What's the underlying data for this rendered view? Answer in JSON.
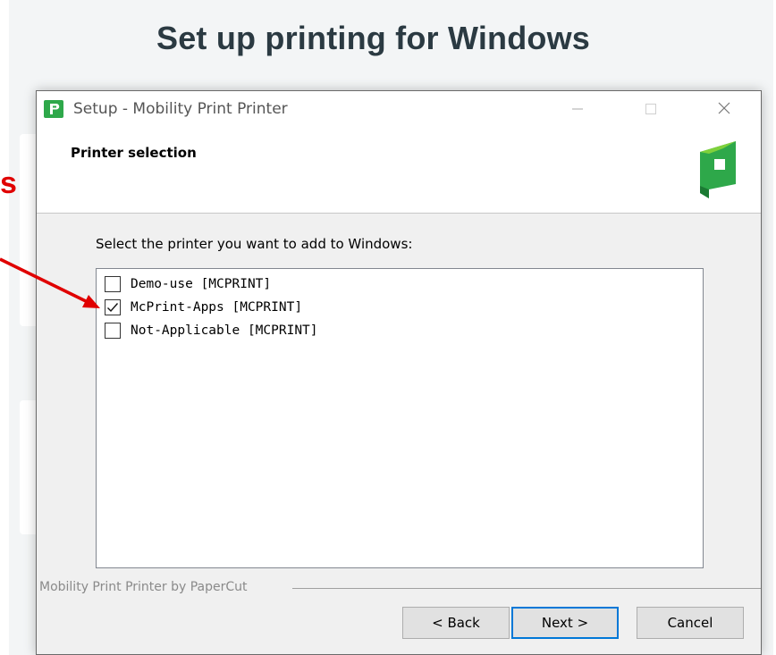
{
  "page": {
    "title": "Set up printing for Windows",
    "annotation_letter": "s",
    "annotation_color": "#e00000"
  },
  "dialog": {
    "window_title": "Setup - Mobility Print Printer",
    "controls": {
      "minimize_icon": "minimize-icon",
      "maximize_icon": "maximize-icon",
      "close_icon": "close-icon"
    },
    "header_title": "Printer selection",
    "logo_icon": "papercut-logo-icon",
    "instruction": "Select the printer you want to add to Windows:",
    "printers": [
      {
        "label": "Demo-use [MCPRINT]",
        "checked": false
      },
      {
        "label": "McPrint-Apps [MCPRINT]",
        "checked": true
      },
      {
        "label": "Not-Applicable [MCPRINT]",
        "checked": false
      }
    ],
    "footer_brand": "Mobility Print Printer by PaperCut",
    "buttons": {
      "back": "< Back",
      "next": "Next >",
      "cancel": "Cancel"
    },
    "accent_color": "#0078d7",
    "brand_color": "#2ea84a"
  }
}
